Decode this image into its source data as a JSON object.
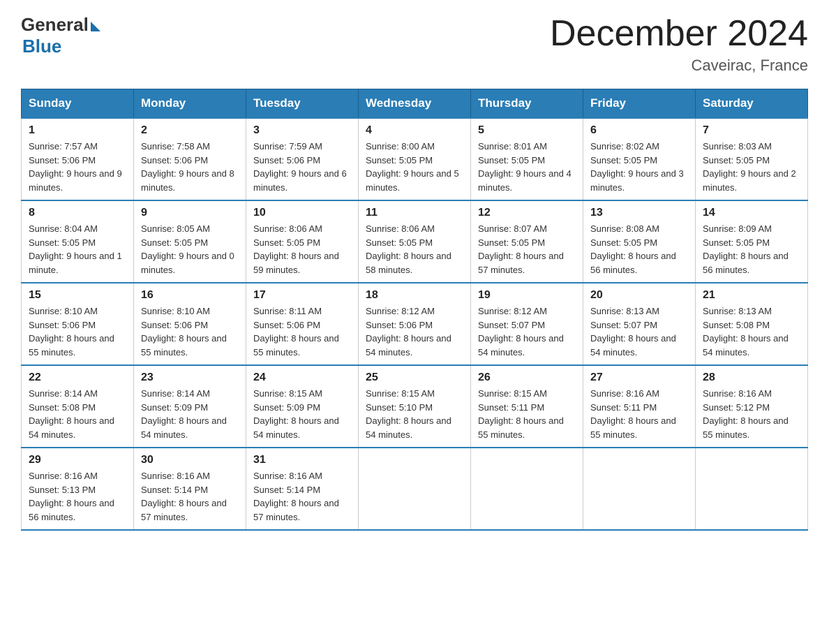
{
  "logo": {
    "general": "General",
    "blue": "Blue"
  },
  "header": {
    "title": "December 2024",
    "subtitle": "Caveirac, France"
  },
  "weekdays": [
    "Sunday",
    "Monday",
    "Tuesday",
    "Wednesday",
    "Thursday",
    "Friday",
    "Saturday"
  ],
  "weeks": [
    [
      {
        "day": "1",
        "sunrise": "7:57 AM",
        "sunset": "5:06 PM",
        "daylight": "9 hours and 9 minutes."
      },
      {
        "day": "2",
        "sunrise": "7:58 AM",
        "sunset": "5:06 PM",
        "daylight": "9 hours and 8 minutes."
      },
      {
        "day": "3",
        "sunrise": "7:59 AM",
        "sunset": "5:06 PM",
        "daylight": "9 hours and 6 minutes."
      },
      {
        "day": "4",
        "sunrise": "8:00 AM",
        "sunset": "5:05 PM",
        "daylight": "9 hours and 5 minutes."
      },
      {
        "day": "5",
        "sunrise": "8:01 AM",
        "sunset": "5:05 PM",
        "daylight": "9 hours and 4 minutes."
      },
      {
        "day": "6",
        "sunrise": "8:02 AM",
        "sunset": "5:05 PM",
        "daylight": "9 hours and 3 minutes."
      },
      {
        "day": "7",
        "sunrise": "8:03 AM",
        "sunset": "5:05 PM",
        "daylight": "9 hours and 2 minutes."
      }
    ],
    [
      {
        "day": "8",
        "sunrise": "8:04 AM",
        "sunset": "5:05 PM",
        "daylight": "9 hours and 1 minute."
      },
      {
        "day": "9",
        "sunrise": "8:05 AM",
        "sunset": "5:05 PM",
        "daylight": "9 hours and 0 minutes."
      },
      {
        "day": "10",
        "sunrise": "8:06 AM",
        "sunset": "5:05 PM",
        "daylight": "8 hours and 59 minutes."
      },
      {
        "day": "11",
        "sunrise": "8:06 AM",
        "sunset": "5:05 PM",
        "daylight": "8 hours and 58 minutes."
      },
      {
        "day": "12",
        "sunrise": "8:07 AM",
        "sunset": "5:05 PM",
        "daylight": "8 hours and 57 minutes."
      },
      {
        "day": "13",
        "sunrise": "8:08 AM",
        "sunset": "5:05 PM",
        "daylight": "8 hours and 56 minutes."
      },
      {
        "day": "14",
        "sunrise": "8:09 AM",
        "sunset": "5:05 PM",
        "daylight": "8 hours and 56 minutes."
      }
    ],
    [
      {
        "day": "15",
        "sunrise": "8:10 AM",
        "sunset": "5:06 PM",
        "daylight": "8 hours and 55 minutes."
      },
      {
        "day": "16",
        "sunrise": "8:10 AM",
        "sunset": "5:06 PM",
        "daylight": "8 hours and 55 minutes."
      },
      {
        "day": "17",
        "sunrise": "8:11 AM",
        "sunset": "5:06 PM",
        "daylight": "8 hours and 55 minutes."
      },
      {
        "day": "18",
        "sunrise": "8:12 AM",
        "sunset": "5:06 PM",
        "daylight": "8 hours and 54 minutes."
      },
      {
        "day": "19",
        "sunrise": "8:12 AM",
        "sunset": "5:07 PM",
        "daylight": "8 hours and 54 minutes."
      },
      {
        "day": "20",
        "sunrise": "8:13 AM",
        "sunset": "5:07 PM",
        "daylight": "8 hours and 54 minutes."
      },
      {
        "day": "21",
        "sunrise": "8:13 AM",
        "sunset": "5:08 PM",
        "daylight": "8 hours and 54 minutes."
      }
    ],
    [
      {
        "day": "22",
        "sunrise": "8:14 AM",
        "sunset": "5:08 PM",
        "daylight": "8 hours and 54 minutes."
      },
      {
        "day": "23",
        "sunrise": "8:14 AM",
        "sunset": "5:09 PM",
        "daylight": "8 hours and 54 minutes."
      },
      {
        "day": "24",
        "sunrise": "8:15 AM",
        "sunset": "5:09 PM",
        "daylight": "8 hours and 54 minutes."
      },
      {
        "day": "25",
        "sunrise": "8:15 AM",
        "sunset": "5:10 PM",
        "daylight": "8 hours and 54 minutes."
      },
      {
        "day": "26",
        "sunrise": "8:15 AM",
        "sunset": "5:11 PM",
        "daylight": "8 hours and 55 minutes."
      },
      {
        "day": "27",
        "sunrise": "8:16 AM",
        "sunset": "5:11 PM",
        "daylight": "8 hours and 55 minutes."
      },
      {
        "day": "28",
        "sunrise": "8:16 AM",
        "sunset": "5:12 PM",
        "daylight": "8 hours and 55 minutes."
      }
    ],
    [
      {
        "day": "29",
        "sunrise": "8:16 AM",
        "sunset": "5:13 PM",
        "daylight": "8 hours and 56 minutes."
      },
      {
        "day": "30",
        "sunrise": "8:16 AM",
        "sunset": "5:14 PM",
        "daylight": "8 hours and 57 minutes."
      },
      {
        "day": "31",
        "sunrise": "8:16 AM",
        "sunset": "5:14 PM",
        "daylight": "8 hours and 57 minutes."
      },
      null,
      null,
      null,
      null
    ]
  ],
  "labels": {
    "sunrise": "Sunrise:",
    "sunset": "Sunset:",
    "daylight": "Daylight:"
  }
}
